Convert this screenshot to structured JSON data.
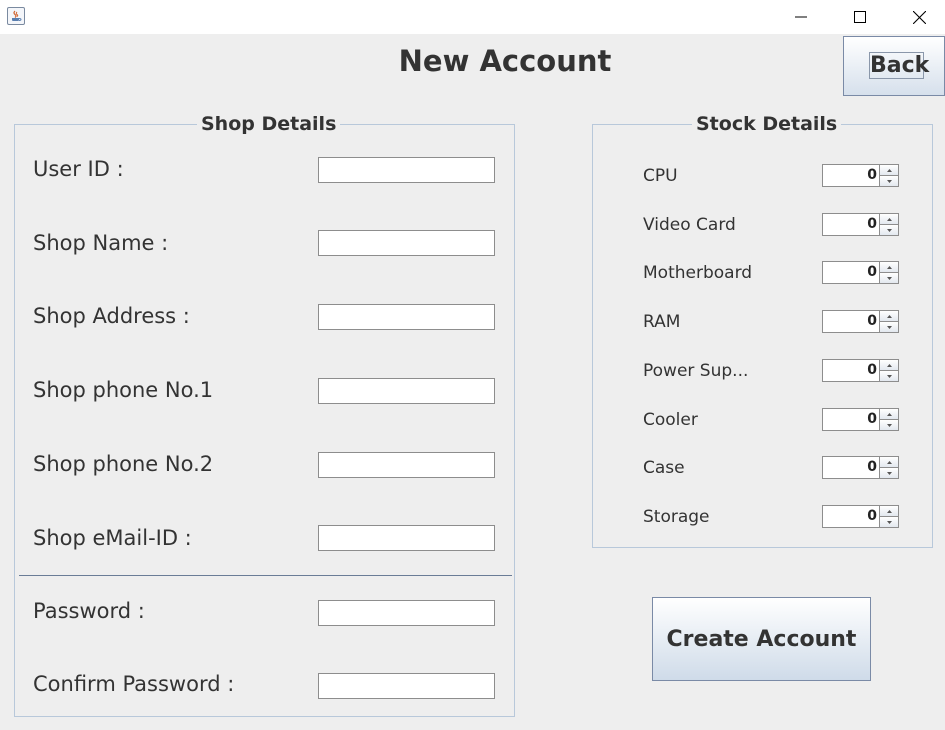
{
  "header": {
    "title": "New Account",
    "back_label": "Back"
  },
  "shop_details": {
    "title": "Shop Details",
    "fields": [
      {
        "label": "User ID :",
        "value": ""
      },
      {
        "label": "Shop Name :",
        "value": ""
      },
      {
        "label": "Shop Address :",
        "value": ""
      },
      {
        "label": "Shop phone No.1",
        "value": ""
      },
      {
        "label": "Shop phone No.2",
        "value": ""
      },
      {
        "label": "Shop eMail-ID :",
        "value": ""
      }
    ],
    "password_fields": [
      {
        "label": "Password :",
        "value": ""
      },
      {
        "label": "Confirm Password :",
        "value": ""
      }
    ]
  },
  "stock_details": {
    "title": "Stock Details",
    "items": [
      {
        "label": "CPU",
        "value": "0"
      },
      {
        "label": "Video Card",
        "value": "0"
      },
      {
        "label": "Motherboard",
        "value": "0"
      },
      {
        "label": "RAM",
        "value": "0"
      },
      {
        "label": "Power Sup...",
        "value": "0"
      },
      {
        "label": "Cooler",
        "value": "0"
      },
      {
        "label": "Case",
        "value": "0"
      },
      {
        "label": "Storage",
        "value": "0"
      }
    ]
  },
  "actions": {
    "create_label": "Create Account"
  },
  "colors": {
    "background": "#eeeeee",
    "panel_border": "#b8c8da",
    "button_gradient_end": "#d6e0ec"
  },
  "icons": {
    "app": "java-icon",
    "minimize": "minimize-icon",
    "maximize": "maximize-icon",
    "close": "close-icon"
  }
}
